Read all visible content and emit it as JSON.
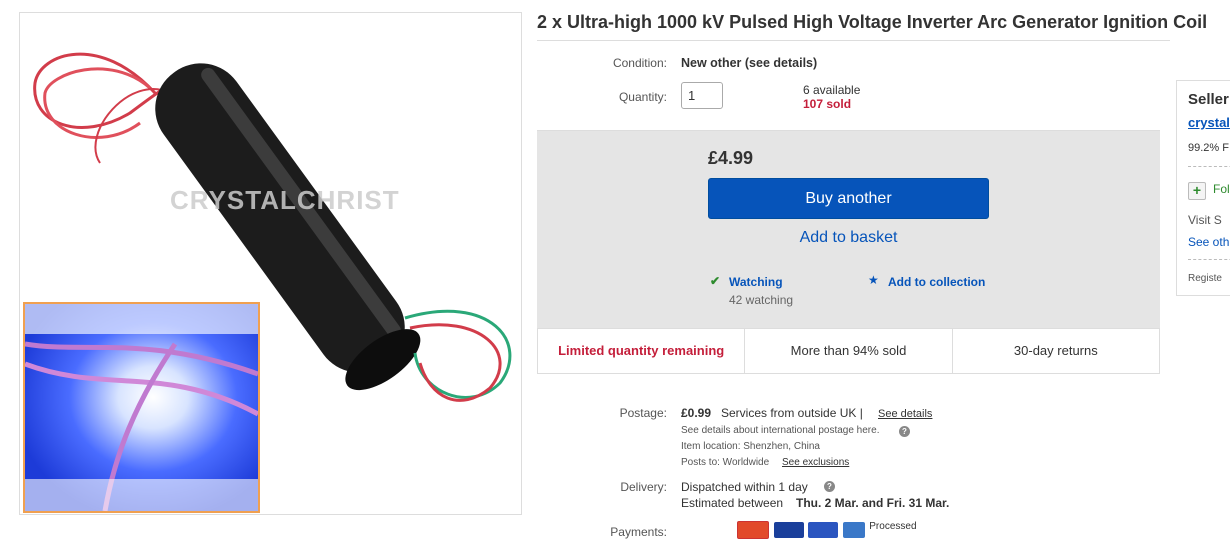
{
  "title": "2 x Ultra-high 1000 kV Pulsed High Voltage Inverter Arc Generator Ignition Coil",
  "image": {
    "watermark": "CRYSTALCHRIST"
  },
  "condition": {
    "label": "Condition:",
    "value": "New other (see details)"
  },
  "quantity": {
    "label": "Quantity:",
    "value": "1",
    "available": "6 available",
    "sold": "107 sold"
  },
  "buy": {
    "price": "£4.99",
    "buy_label": "Buy another",
    "basket_label": "Add to basket",
    "watching_label": "Watching",
    "watching_count": "42 watching",
    "collection_label": "Add to collection"
  },
  "badges": [
    "Limited quantity remaining",
    "More than 94% sold",
    "30-day returns"
  ],
  "postage": {
    "label": "Postage:",
    "price": "£0.99",
    "service": "Services from outside UK |",
    "see_details": "See details",
    "intl_note": "See details about international postage here.",
    "location": "Item location:  Shenzhen, China",
    "posts_to": "Posts to:  Worldwide",
    "exclusions": "See exclusions"
  },
  "delivery": {
    "label": "Delivery:",
    "dispatch": "Dispatched within 1 day",
    "estimate_prefix": "Estimated between",
    "estimate_dates": "Thu. 2 Mar. and Fri. 31 Mar."
  },
  "payments": {
    "label": "Payments:",
    "processed": "Processed"
  },
  "seller": {
    "heading": "Seller",
    "name": "crystal",
    "feedback": "99.2% F",
    "follow": "Fol",
    "visit": "Visit S",
    "see_other": "See oth",
    "registered": "Registe"
  },
  "colors": {
    "link": "#0654ba",
    "accent_red": "#c41e3a",
    "button": "#0654ba",
    "panel_grey": "#e5e5e5"
  }
}
